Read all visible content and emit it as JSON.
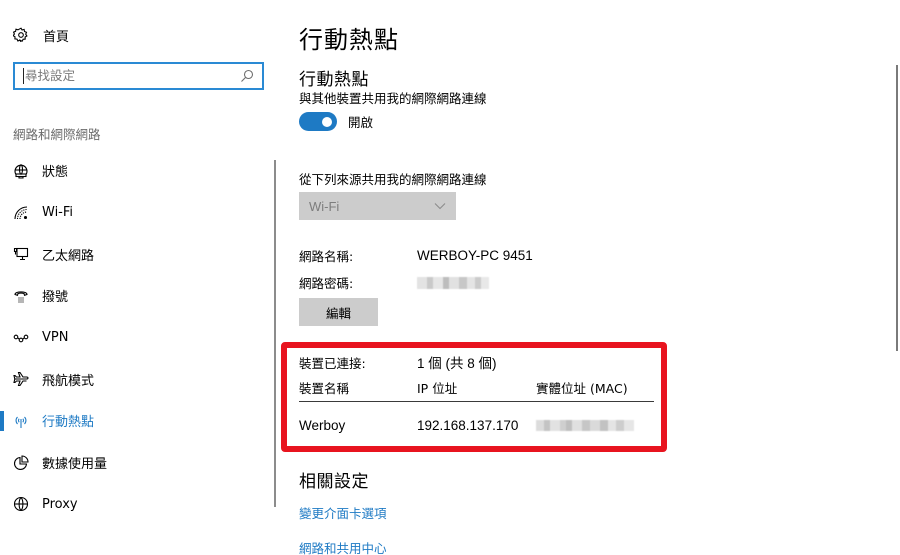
{
  "sidebar": {
    "home_label": "首頁",
    "search_placeholder": "尋找設定",
    "section_title": "網路和網際網路",
    "items": [
      {
        "label": "狀態",
        "icon": "globe-status-icon"
      },
      {
        "label": "Wi-Fi",
        "icon": "wifi-icon"
      },
      {
        "label": "乙太網路",
        "icon": "ethernet-icon"
      },
      {
        "label": "撥號",
        "icon": "dialup-icon"
      },
      {
        "label": "VPN",
        "icon": "vpn-icon"
      },
      {
        "label": "飛航模式",
        "icon": "airplane-icon"
      },
      {
        "label": "行動熱點",
        "icon": "hotspot-icon",
        "active": true
      },
      {
        "label": "數據使用量",
        "icon": "data-usage-icon"
      },
      {
        "label": "Proxy",
        "icon": "proxy-globe-icon"
      }
    ]
  },
  "main": {
    "page_title": "行動熱點",
    "hotspot": {
      "title": "行動熱點",
      "description": "與其他裝置共用我的網際網路連線",
      "toggle_state": "on",
      "toggle_label": "開啟"
    },
    "source": {
      "label": "從下列來源共用我的網際網路連線",
      "selected": "Wi-Fi"
    },
    "network_name_label": "網路名稱:",
    "network_name_value": "WERBOY-PC 9451",
    "network_password_label": "網路密碼:",
    "edit_button": "編輯",
    "devices": {
      "connected_label": "裝置已連接:",
      "connected_value": "1 個 (共 8 個)",
      "headers": [
        "裝置名稱",
        "IP 位址",
        "實體位址 (MAC)"
      ],
      "rows": [
        {
          "name": "Werboy",
          "ip": "192.168.137.170"
        }
      ]
    },
    "related": {
      "title": "相關設定",
      "links": [
        "變更介面卡選項",
        "網路和共用中心"
      ]
    }
  },
  "colors": {
    "accent": "#1e7ac4",
    "highlight_box": "#e8141f"
  }
}
